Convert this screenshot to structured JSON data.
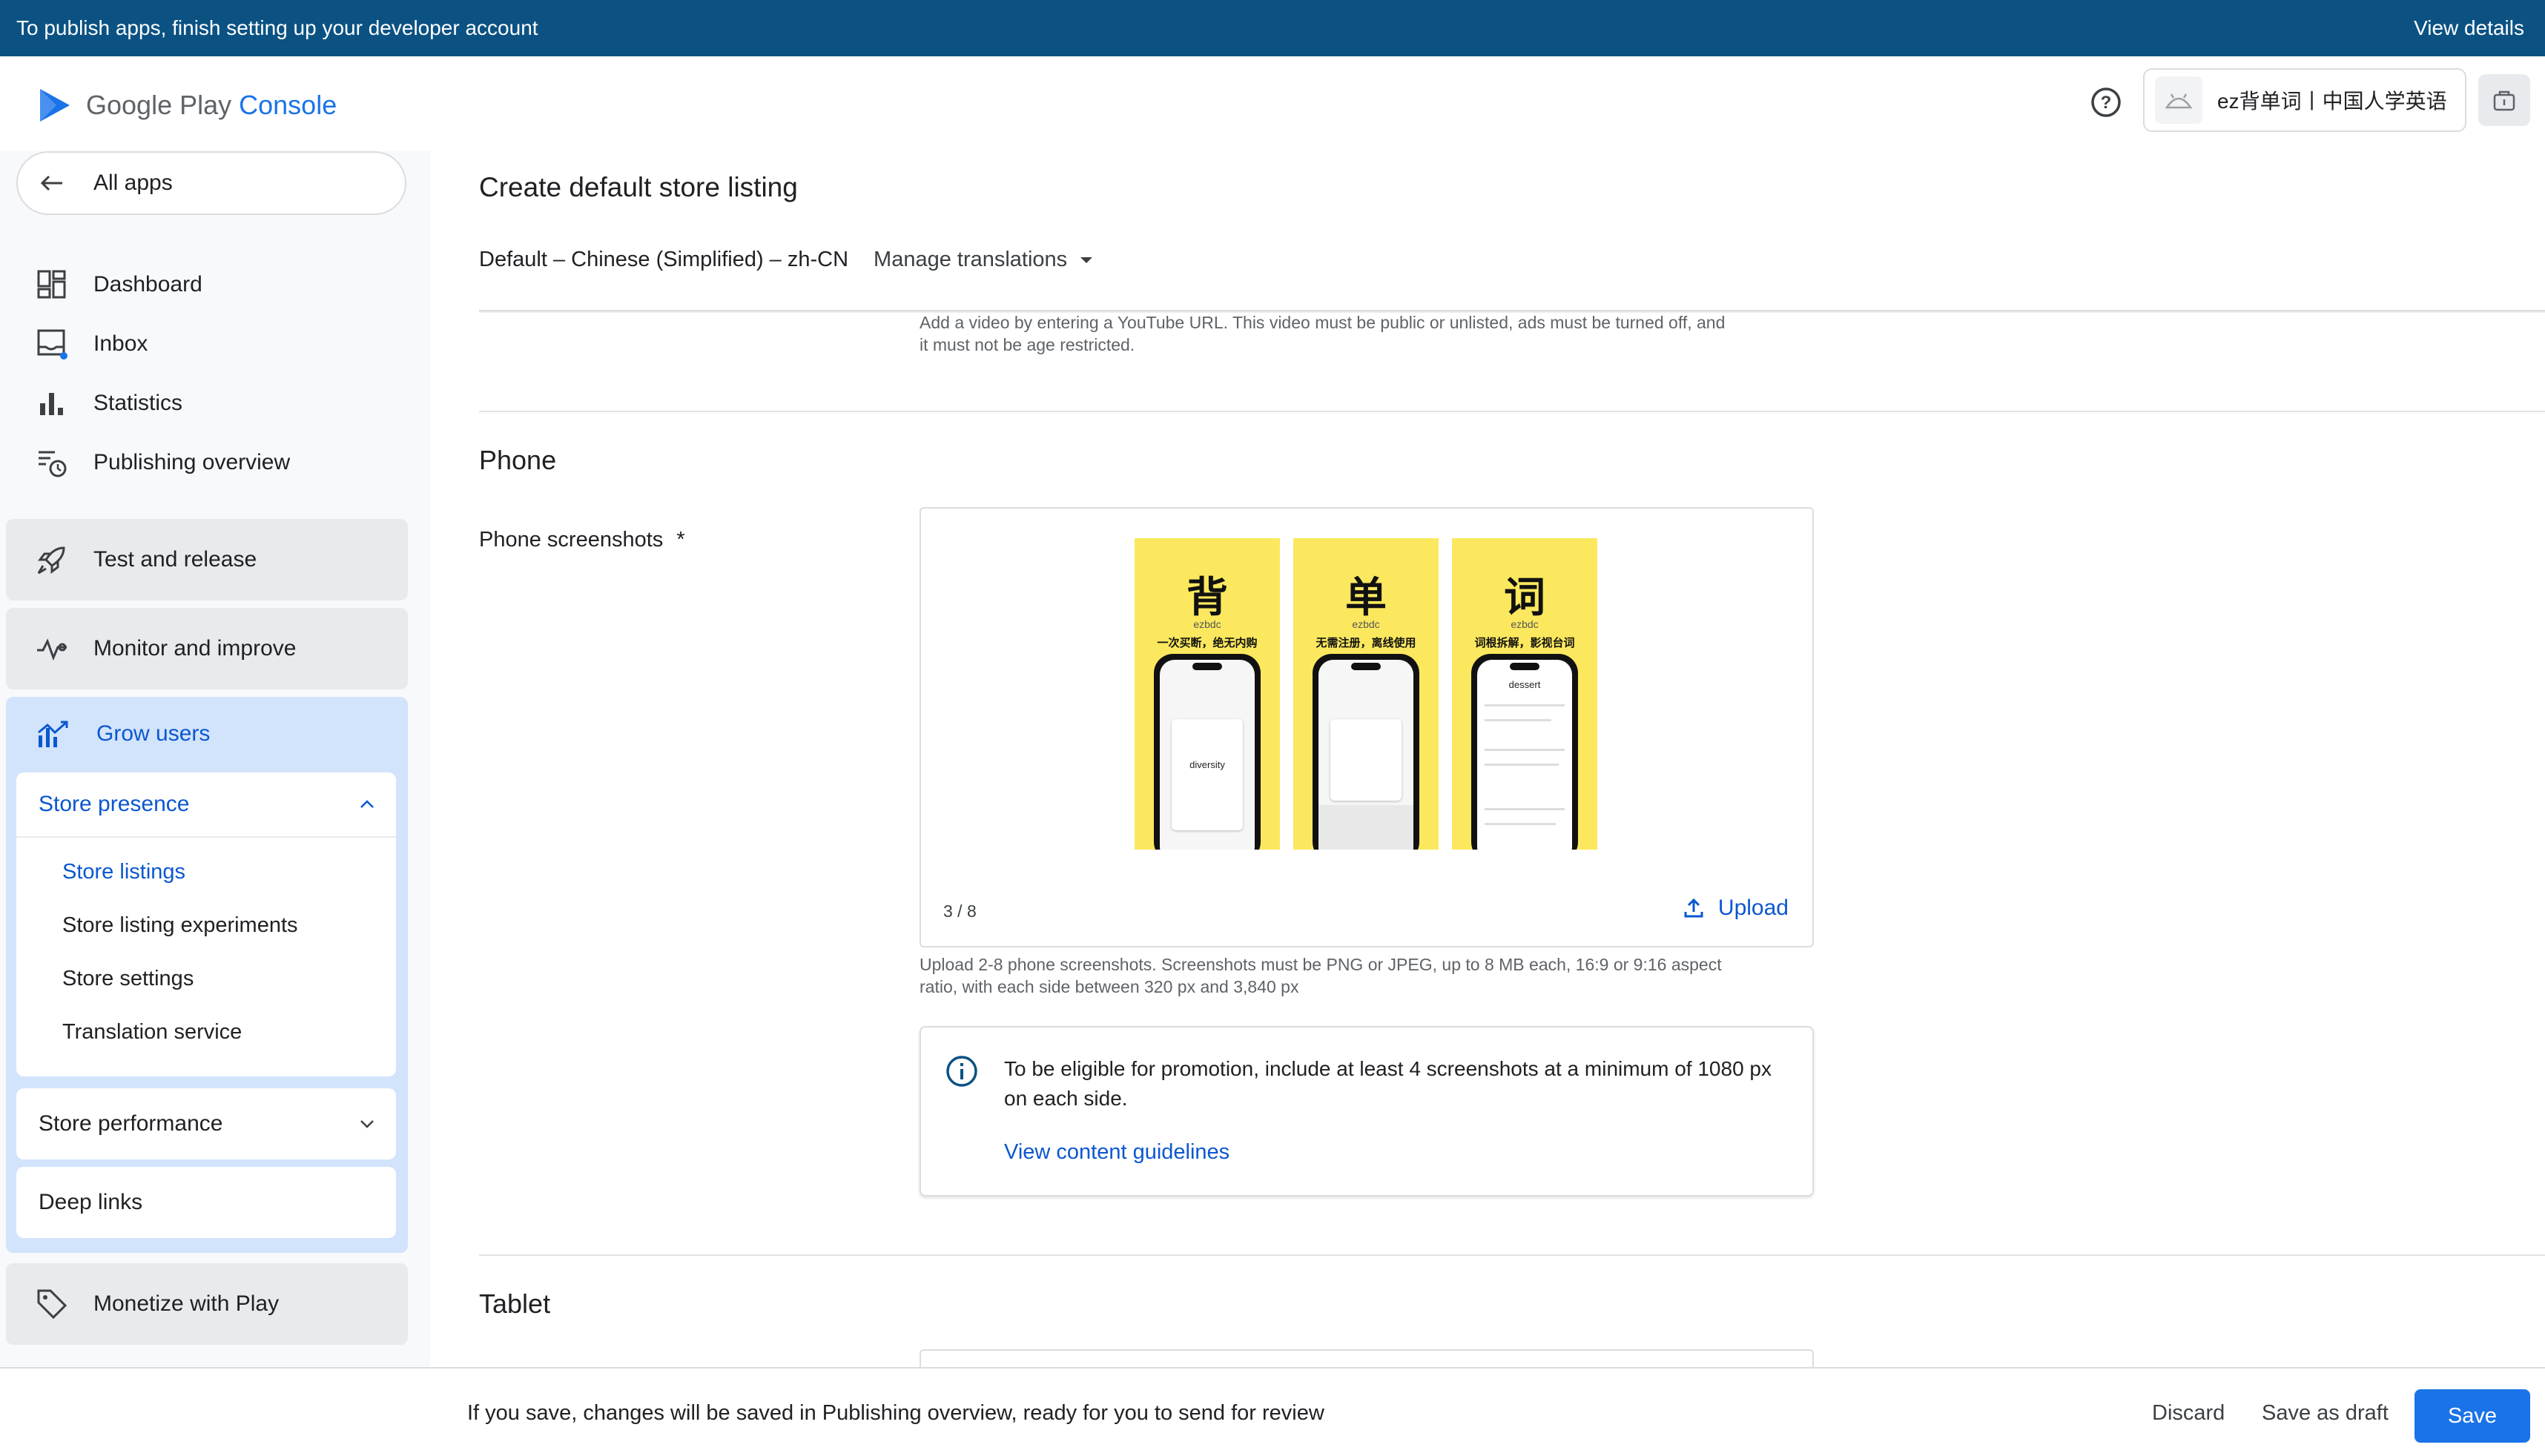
{
  "banner": {
    "message": "To publish apps, finish setting up your developer account",
    "action": "View details"
  },
  "header": {
    "logo_text": "Google Play",
    "logo_accent": "Console",
    "app_name": "ez背单词丨中国人学英语"
  },
  "sidebar": {
    "all_apps": "All apps",
    "items": [
      {
        "label": "Dashboard",
        "icon": "dashboard-icon"
      },
      {
        "label": "Inbox",
        "icon": "inbox-icon"
      },
      {
        "label": "Statistics",
        "icon": "bar-chart-icon"
      },
      {
        "label": "Publishing overview",
        "icon": "publishing-icon"
      }
    ],
    "groups": [
      {
        "label": "Test and release",
        "icon": "rocket-icon"
      },
      {
        "label": "Monitor and improve",
        "icon": "pulse-icon"
      },
      {
        "label": "Grow users",
        "icon": "grow-icon"
      },
      {
        "label": "Monetize with Play",
        "icon": "tag-icon"
      }
    ],
    "store_presence": {
      "label": "Store presence",
      "items": [
        "Store listings",
        "Store listing experiments",
        "Store settings",
        "Translation service"
      ]
    },
    "store_performance": "Store performance",
    "deep_links": "Deep links"
  },
  "main": {
    "title": "Create default store listing",
    "language": "Default – Chinese (Simplified) – zh-CN",
    "manage_translations": "Manage translations",
    "video_hint_1": "Add a video by entering a YouTube URL. This video must be public or unlisted, ads must be turned off, and",
    "video_hint_2": "it must not be age restricted.",
    "phone_section": "Phone",
    "phone_screenshots_label": "Phone screenshots",
    "required_mark": "*",
    "screenshots": [
      {
        "char": "背",
        "brand": "ezbdc",
        "caption": "一次买断，绝无内购",
        "word": "diversity"
      },
      {
        "char": "单",
        "brand": "ezbdc",
        "caption": "无需注册，离线使用",
        "word": ""
      },
      {
        "char": "词",
        "brand": "ezbdc",
        "caption": "词根拆解，影视台词",
        "word": "dessert"
      }
    ],
    "screenshot_count": "3 / 8",
    "upload_label": "Upload",
    "upload_hint_1": "Upload 2-8 phone screenshots. Screenshots must be PNG or JPEG, up to 8 MB each, 16:9 or 9:16 aspect",
    "upload_hint_2": "ratio, with each side between 320 px and 3,840 px",
    "promo_text": "To be eligible for promotion, include at least 4 screenshots at a minimum of 1080 px on each side.",
    "promo_link": "View content guidelines",
    "tablet_section": "Tablet"
  },
  "footer": {
    "message": "If you save, changes will be saved in Publishing overview, ready for you to send for review",
    "discard": "Discard",
    "save_draft": "Save as draft",
    "save": "Save"
  },
  "colors": {
    "banner": "#0b5283",
    "accent": "#1a73e8",
    "active_text": "#0b57d0",
    "grow_bg": "#d2e3fc"
  }
}
